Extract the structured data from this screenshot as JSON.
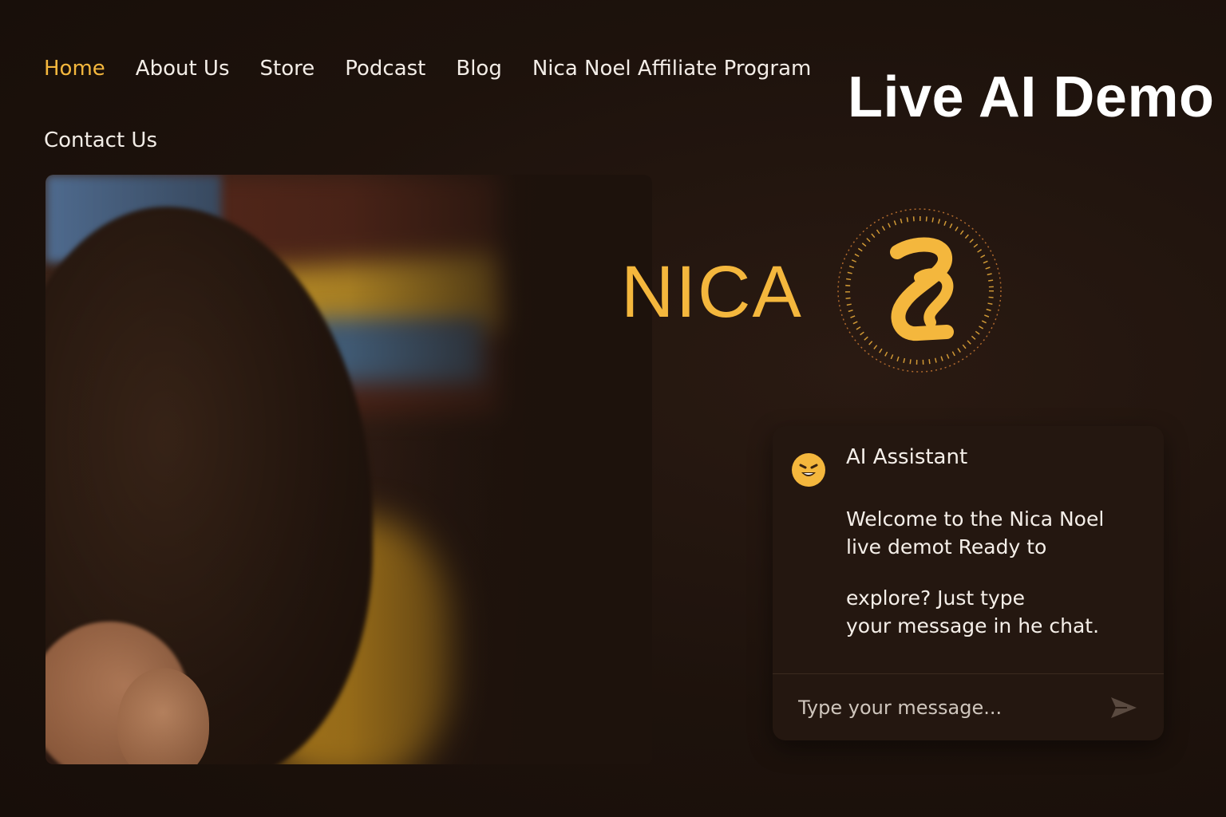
{
  "nav": {
    "items": [
      {
        "label": "Home",
        "active": true
      },
      {
        "label": "About Us"
      },
      {
        "label": "Store"
      },
      {
        "label": "Podcast"
      },
      {
        "label": "Blog"
      },
      {
        "label": "Nica Noel Affiliate Program"
      },
      {
        "label": "Contact Us"
      }
    ]
  },
  "header": {
    "title": "Live AI Demo"
  },
  "brand": {
    "name": "NICA",
    "logo_icon": "nica-monogram-icon",
    "accent": "#f4b73d"
  },
  "hero": {
    "image": "portrait-photo"
  },
  "chat": {
    "assistant_name": "AI Assistant",
    "avatar_icon": "smiley-avatar-icon",
    "message_line1": "Welcome to the Nica Noel",
    "message_line2": "live demot Ready to",
    "message_line3": "explore? Just type",
    "message_line4": "your message in he chat.",
    "input_placeholder": "Type your message...",
    "send_icon": "send-icon"
  },
  "colors": {
    "background": "#1d120c",
    "accent": "#f4b73d",
    "text": "#f3ede7"
  }
}
